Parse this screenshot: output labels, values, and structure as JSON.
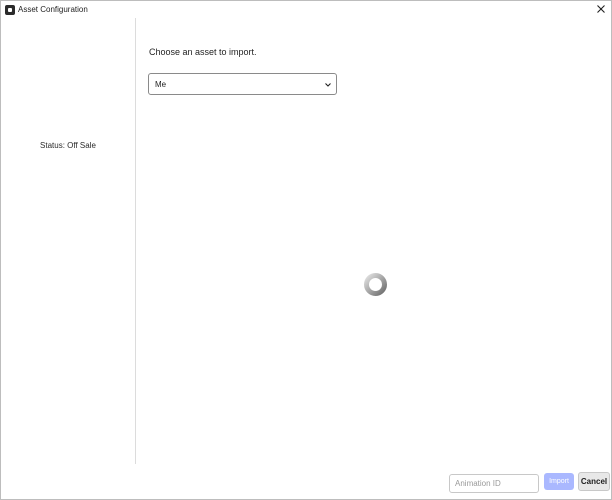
{
  "window": {
    "title": "Asset Configuration",
    "icon": "roblox-studio-icon",
    "close_icon": "close-icon"
  },
  "sidebar": {
    "status_text": "Status: Off Sale"
  },
  "main": {
    "prompt": "Choose an asset to import.",
    "asset_source_select": {
      "selected": "Me",
      "icon": "chevron-down-icon"
    },
    "loading_indicator": "loading-spinner-icon"
  },
  "footer": {
    "animation_id_input": {
      "value": "",
      "placeholder": "Animation ID"
    },
    "import_label": "Import",
    "cancel_label": "Cancel"
  },
  "colors": {
    "primary_disabled": "#aab8ff",
    "divider": "#dcdcdc",
    "spinner_dark": "#6e6e6e",
    "spinner_light": "#e0e0e0"
  }
}
